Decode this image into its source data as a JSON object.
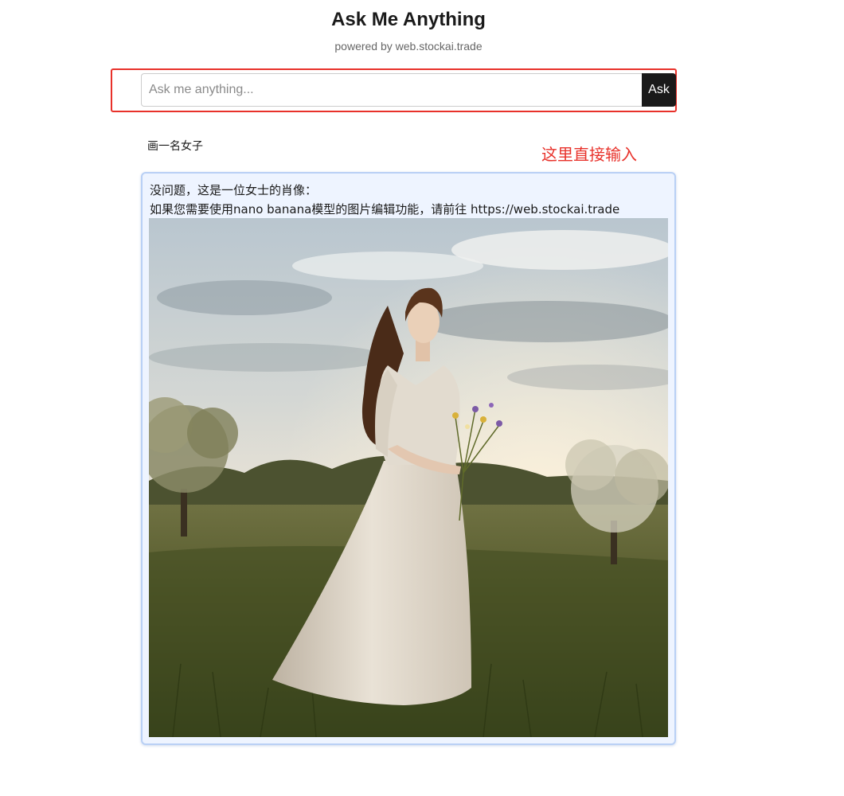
{
  "header": {
    "title": "Ask Me Anything",
    "subtitle": "powered by web.stockai.trade"
  },
  "search": {
    "placeholder": "Ask me anything...",
    "value": "",
    "button_label": "Ask"
  },
  "annotation": {
    "text": "这里直接输入",
    "color": "#e8312a"
  },
  "conversation": {
    "user_message": "画一名女子",
    "reply": {
      "line1": "没问题，这是一位女士的肖像：",
      "line2": "如果您需要使用nano banana模型的图片编辑功能，请前往 https://web.stockai.trade",
      "image_subject": "woman-in-meadow-photo"
    }
  },
  "colors": {
    "accent_red": "#e8312a",
    "button_dark": "#1a1a1a",
    "card_bg": "#eef4ff",
    "card_border": "#b9d0f5"
  }
}
